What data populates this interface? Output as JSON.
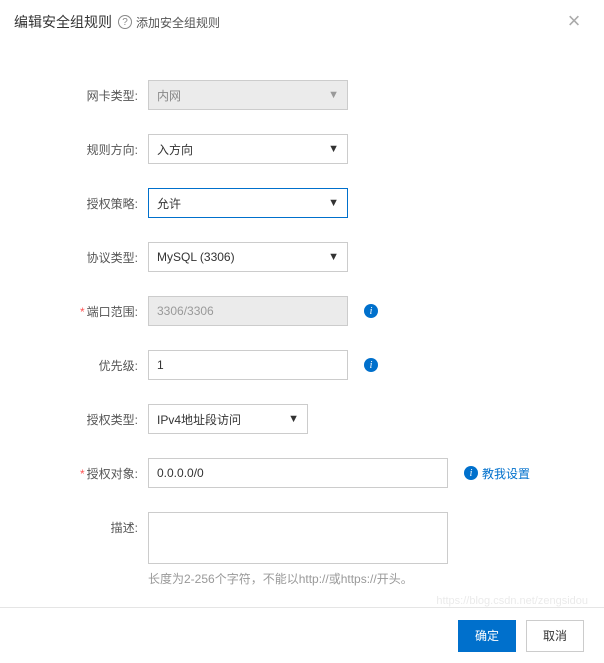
{
  "header": {
    "title": "编辑安全组规则",
    "help_link": "添加安全组规则"
  },
  "fields": {
    "nic_type": {
      "label": "网卡类型:",
      "value": "内网"
    },
    "rule_direction": {
      "label": "规则方向:",
      "value": "入方向"
    },
    "auth_policy": {
      "label": "授权策略:",
      "value": "允许"
    },
    "protocol_type": {
      "label": "协议类型:",
      "value": "MySQL (3306)"
    },
    "port_range": {
      "label": "端口范围:",
      "value": "3306/3306"
    },
    "priority": {
      "label": "优先级:",
      "value": "1"
    },
    "auth_type": {
      "label": "授权类型:",
      "value": "IPv4地址段访问"
    },
    "auth_object": {
      "label": "授权对象:",
      "value": "0.0.0.0/0",
      "help": "教我设置"
    },
    "description": {
      "label": "描述:",
      "hint": "长度为2-256个字符，不能以http://或https://开头。"
    }
  },
  "footer": {
    "ok": "确定",
    "cancel": "取消"
  },
  "watermark": "https://blog.csdn.net/zengsidou"
}
